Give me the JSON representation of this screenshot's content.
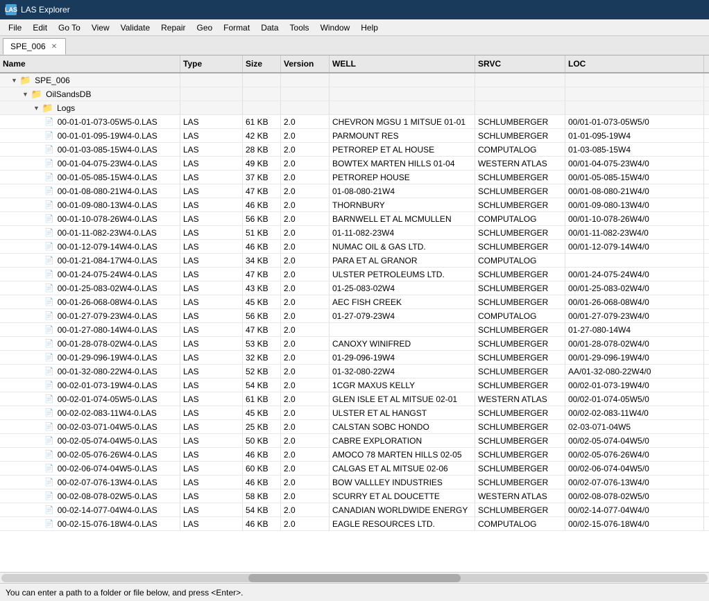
{
  "titleBar": {
    "appName": "LAS Explorer",
    "icon": "LAS"
  },
  "menuBar": {
    "items": [
      "File",
      "Edit",
      "Go To",
      "View",
      "Validate",
      "Repair",
      "Geo",
      "Format",
      "Data",
      "Tools",
      "Window",
      "Help"
    ]
  },
  "tabs": [
    {
      "label": "SPE_006",
      "active": true
    }
  ],
  "columns": [
    {
      "key": "name",
      "label": "Name"
    },
    {
      "key": "type",
      "label": "Type"
    },
    {
      "key": "size",
      "label": "Size"
    },
    {
      "key": "version",
      "label": "Version"
    },
    {
      "key": "well",
      "label": "WELL"
    },
    {
      "key": "srvc",
      "label": "SRVC"
    },
    {
      "key": "loc",
      "label": "LOC"
    }
  ],
  "tree": [
    {
      "indent": 1,
      "type": "folder",
      "expanded": true,
      "name": "SPE_006",
      "ftype": "<Folder>",
      "size": "",
      "version": "",
      "well": "",
      "srvc": "",
      "loc": ""
    },
    {
      "indent": 2,
      "type": "folder",
      "expanded": true,
      "name": "OilSandsDB",
      "ftype": "<Folder>",
      "size": "",
      "version": "",
      "well": "",
      "srvc": "",
      "loc": ""
    },
    {
      "indent": 3,
      "type": "folder",
      "expanded": true,
      "name": "Logs",
      "ftype": "<Folder>",
      "size": "",
      "version": "",
      "well": "",
      "srvc": "",
      "loc": ""
    },
    {
      "indent": 4,
      "type": "file",
      "name": "00-01-01-073-05W5-0.LAS",
      "ftype": "LAS",
      "size": "61 KB",
      "version": "2.0",
      "well": "CHEVRON MGSU 1 MITSUE 01-01",
      "srvc": "SCHLUMBERGER",
      "loc": "00/01-01-073-05W5/0"
    },
    {
      "indent": 4,
      "type": "file",
      "name": "00-01-01-095-19W4-0.LAS",
      "ftype": "LAS",
      "size": "42 KB",
      "version": "2.0",
      "well": "PARMOUNT RES",
      "srvc": "SCHLUMBERGER",
      "loc": "01-01-095-19W4"
    },
    {
      "indent": 4,
      "type": "file",
      "name": "00-01-03-085-15W4-0.LAS",
      "ftype": "LAS",
      "size": "28 KB",
      "version": "2.0",
      "well": "PETROREP ET AL HOUSE",
      "srvc": "COMPUTALOG",
      "loc": "01-03-085-15W4"
    },
    {
      "indent": 4,
      "type": "file",
      "name": "00-01-04-075-23W4-0.LAS",
      "ftype": "LAS",
      "size": "49 KB",
      "version": "2.0",
      "well": "BOWTEX MARTEN HILLS 01-04",
      "srvc": "WESTERN ATLAS",
      "loc": "00/01-04-075-23W4/0"
    },
    {
      "indent": 4,
      "type": "file",
      "name": "00-01-05-085-15W4-0.LAS",
      "ftype": "LAS",
      "size": "37 KB",
      "version": "2.0",
      "well": "PETROREP HOUSE",
      "srvc": "SCHLUMBERGER",
      "loc": "00/01-05-085-15W4/0"
    },
    {
      "indent": 4,
      "type": "file",
      "name": "00-01-08-080-21W4-0.LAS",
      "ftype": "LAS",
      "size": "47 KB",
      "version": "2.0",
      "well": "01-08-080-21W4",
      "srvc": "SCHLUMBERGER",
      "loc": "00/01-08-080-21W4/0"
    },
    {
      "indent": 4,
      "type": "file",
      "name": "00-01-09-080-13W4-0.LAS",
      "ftype": "LAS",
      "size": "46 KB",
      "version": "2.0",
      "well": "THORNBURY",
      "srvc": "SCHLUMBERGER",
      "loc": "00/01-09-080-13W4/0"
    },
    {
      "indent": 4,
      "type": "file",
      "name": "00-01-10-078-26W4-0.LAS",
      "ftype": "LAS",
      "size": "56 KB",
      "version": "2.0",
      "well": "BARNWELL ET AL MCMULLEN",
      "srvc": "COMPUTALOG",
      "loc": "00/01-10-078-26W4/0"
    },
    {
      "indent": 4,
      "type": "file",
      "name": "00-01-11-082-23W4-0.LAS",
      "ftype": "LAS",
      "size": "51 KB",
      "version": "2.0",
      "well": "01-11-082-23W4",
      "srvc": "SCHLUMBERGER",
      "loc": "00/01-11-082-23W4/0"
    },
    {
      "indent": 4,
      "type": "file",
      "name": "00-01-12-079-14W4-0.LAS",
      "ftype": "LAS",
      "size": "46 KB",
      "version": "2.0",
      "well": "NUMAC OIL & GAS LTD.",
      "srvc": "SCHLUMBERGER",
      "loc": "00/01-12-079-14W4/0"
    },
    {
      "indent": 4,
      "type": "file",
      "name": "00-01-21-084-17W4-0.LAS",
      "ftype": "LAS",
      "size": "34 KB",
      "version": "2.0",
      "well": "PARA ET AL GRANOR",
      "srvc": "COMPUTALOG",
      "loc": ""
    },
    {
      "indent": 4,
      "type": "file",
      "name": "00-01-24-075-24W4-0.LAS",
      "ftype": "LAS",
      "size": "47 KB",
      "version": "2.0",
      "well": "ULSTER PETROLEUMS LTD.",
      "srvc": "SCHLUMBERGER",
      "loc": "00/01-24-075-24W4/0"
    },
    {
      "indent": 4,
      "type": "file",
      "name": "00-01-25-083-02W4-0.LAS",
      "ftype": "LAS",
      "size": "43 KB",
      "version": "2.0",
      "well": "01-25-083-02W4",
      "srvc": "SCHLUMBERGER",
      "loc": "00/01-25-083-02W4/0"
    },
    {
      "indent": 4,
      "type": "file",
      "name": "00-01-26-068-08W4-0.LAS",
      "ftype": "LAS",
      "size": "45 KB",
      "version": "2.0",
      "well": "AEC FISH CREEK",
      "srvc": "SCHLUMBERGER",
      "loc": "00/01-26-068-08W4/0"
    },
    {
      "indent": 4,
      "type": "file",
      "name": "00-01-27-079-23W4-0.LAS",
      "ftype": "LAS",
      "size": "56 KB",
      "version": "2.0",
      "well": "01-27-079-23W4",
      "srvc": "COMPUTALOG",
      "loc": "00/01-27-079-23W4/0"
    },
    {
      "indent": 4,
      "type": "file",
      "name": "00-01-27-080-14W4-0.LAS",
      "ftype": "LAS",
      "size": "47 KB",
      "version": "2.0",
      "well": "",
      "srvc": "SCHLUMBERGER",
      "loc": "01-27-080-14W4"
    },
    {
      "indent": 4,
      "type": "file",
      "name": "00-01-28-078-02W4-0.LAS",
      "ftype": "LAS",
      "size": "53 KB",
      "version": "2.0",
      "well": "CANOXY WINIFRED",
      "srvc": "SCHLUMBERGER",
      "loc": "00/01-28-078-02W4/0"
    },
    {
      "indent": 4,
      "type": "file",
      "name": "00-01-29-096-19W4-0.LAS",
      "ftype": "LAS",
      "size": "32 KB",
      "version": "2.0",
      "well": "01-29-096-19W4",
      "srvc": "SCHLUMBERGER",
      "loc": "00/01-29-096-19W4/0"
    },
    {
      "indent": 4,
      "type": "file",
      "name": "00-01-32-080-22W4-0.LAS",
      "ftype": "LAS",
      "size": "52 KB",
      "version": "2.0",
      "well": "01-32-080-22W4",
      "srvc": "SCHLUMBERGER",
      "loc": "AA/01-32-080-22W4/0"
    },
    {
      "indent": 4,
      "type": "file",
      "name": "00-02-01-073-19W4-0.LAS",
      "ftype": "LAS",
      "size": "54 KB",
      "version": "2.0",
      "well": "1CGR MAXUS KELLY",
      "srvc": "SCHLUMBERGER",
      "loc": "00/02-01-073-19W4/0"
    },
    {
      "indent": 4,
      "type": "file",
      "name": "00-02-01-074-05W5-0.LAS",
      "ftype": "LAS",
      "size": "61 KB",
      "version": "2.0",
      "well": "GLEN ISLE ET AL MITSUE 02-01",
      "srvc": "WESTERN ATLAS",
      "loc": "00/02-01-074-05W5/0"
    },
    {
      "indent": 4,
      "type": "file",
      "name": "00-02-02-083-11W4-0.LAS",
      "ftype": "LAS",
      "size": "45 KB",
      "version": "2.0",
      "well": "ULSTER ET AL HANGST",
      "srvc": "SCHLUMBERGER",
      "loc": "00/02-02-083-11W4/0"
    },
    {
      "indent": 4,
      "type": "file",
      "name": "00-02-03-071-04W5-0.LAS",
      "ftype": "LAS",
      "size": "25 KB",
      "version": "2.0",
      "well": "CALSTAN SOBC HONDO",
      "srvc": "SCHLUMBERGER",
      "loc": "02-03-071-04W5"
    },
    {
      "indent": 4,
      "type": "file",
      "name": "00-02-05-074-04W5-0.LAS",
      "ftype": "LAS",
      "size": "50 KB",
      "version": "2.0",
      "well": "CABRE EXPLORATION",
      "srvc": "SCHLUMBERGER",
      "loc": "00/02-05-074-04W5/0"
    },
    {
      "indent": 4,
      "type": "file",
      "name": "00-02-05-076-26W4-0.LAS",
      "ftype": "LAS",
      "size": "46 KB",
      "version": "2.0",
      "well": "AMOCO 78 MARTEN HILLS 02-05",
      "srvc": "SCHLUMBERGER",
      "loc": "00/02-05-076-26W4/0"
    },
    {
      "indent": 4,
      "type": "file",
      "name": "00-02-06-074-04W5-0.LAS",
      "ftype": "LAS",
      "size": "60 KB",
      "version": "2.0",
      "well": "CALGAS ET AL MITSUE 02-06",
      "srvc": "SCHLUMBERGER",
      "loc": "00/02-06-074-04W5/0"
    },
    {
      "indent": 4,
      "type": "file",
      "name": "00-02-07-076-13W4-0.LAS",
      "ftype": "LAS",
      "size": "46 KB",
      "version": "2.0",
      "well": "BOW VALLLEY INDUSTRIES",
      "srvc": "SCHLUMBERGER",
      "loc": "00/02-07-076-13W4/0"
    },
    {
      "indent": 4,
      "type": "file",
      "name": "00-02-08-078-02W5-0.LAS",
      "ftype": "LAS",
      "size": "58 KB",
      "version": "2.0",
      "well": "SCURRY ET AL DOUCETTE",
      "srvc": "WESTERN ATLAS",
      "loc": "00/02-08-078-02W5/0"
    },
    {
      "indent": 4,
      "type": "file",
      "name": "00-02-14-077-04W4-0.LAS",
      "ftype": "LAS",
      "size": "54 KB",
      "version": "2.0",
      "well": "CANADIAN WORLDWIDE ENERGY",
      "srvc": "SCHLUMBERGER",
      "loc": "00/02-14-077-04W4/0"
    },
    {
      "indent": 4,
      "type": "file",
      "name": "00-02-15-076-18W4-0.LAS",
      "ftype": "LAS",
      "size": "46 KB",
      "version": "2.0",
      "well": "EAGLE RESOURCES LTD.",
      "srvc": "COMPUTALOG",
      "loc": "00/02-15-076-18W4/0"
    }
  ],
  "statusBar": {
    "message": "You can enter a path to a folder or file below, and press <Enter>."
  }
}
